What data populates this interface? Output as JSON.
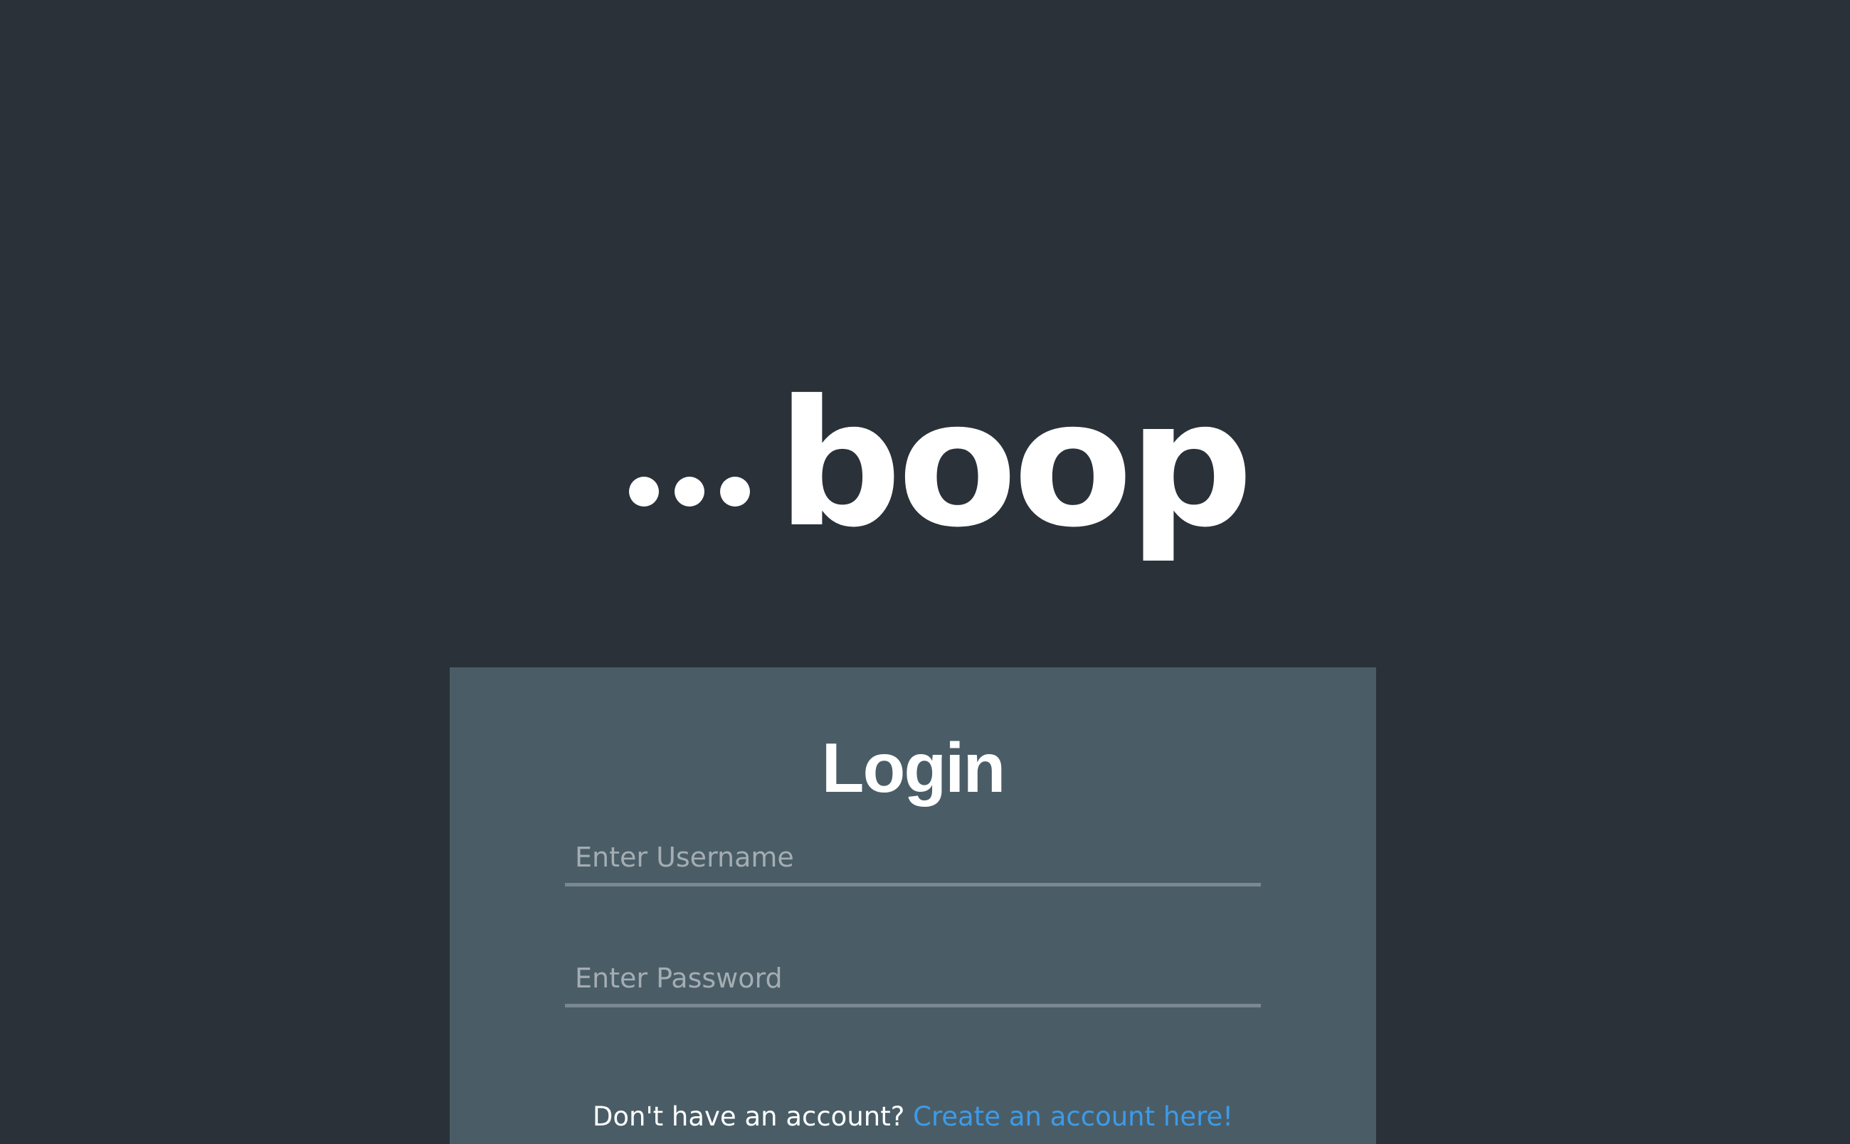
{
  "brand": {
    "logo_text": "boop",
    "logo_icon": "ellipsis-dots-icon"
  },
  "login": {
    "title": "Login",
    "username_placeholder": "Enter Username",
    "username_value": "",
    "password_placeholder": "Enter Password",
    "password_value": "",
    "signup_prompt": "Don't have an account?",
    "signup_link": "Create an account here!"
  },
  "colors": {
    "background": "#2a3139",
    "card": "#4a5d67",
    "link": "#3d9be8",
    "text": "#ffffff",
    "field_underline": "#7a8991"
  }
}
